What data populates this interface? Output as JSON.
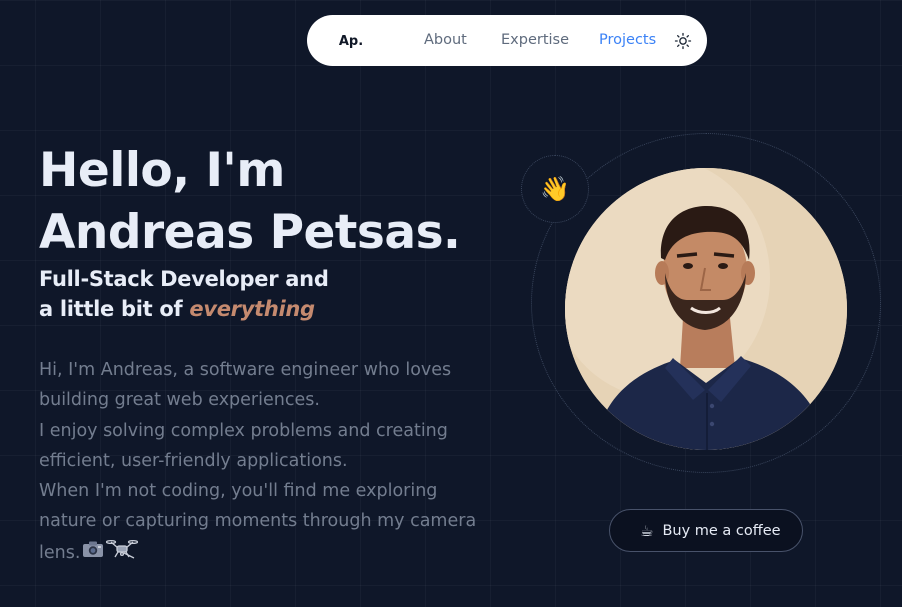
{
  "nav": {
    "logo": "Ap.",
    "links": [
      "About",
      "Expertise",
      "Projects"
    ],
    "active": "Projects",
    "theme_icon": "sun-icon"
  },
  "hero": {
    "title_line1": "Hello, I'm",
    "title_line2": "Andreas Petsas.",
    "subtitle_line1": "Full-Stack Developer and",
    "subtitle_line2_prefix": "a little bit of ",
    "subtitle_accent": "everything",
    "bio_lines": [
      "Hi, I'm Andreas, a software engineer who loves",
      "building great web experiences.",
      "I enjoy solving complex problems and creating",
      "efficient, user-friendly applications.",
      "When I'm not coding, you'll find me exploring",
      "nature or capturing moments through my camera",
      "lens."
    ],
    "bio_icons": [
      "camera-icon",
      "drone-icon"
    ],
    "wave_emoji": "👋"
  },
  "coffee": {
    "label": "Buy me a coffee",
    "icon": "☕"
  },
  "colors": {
    "background": "#0f1729",
    "accent_blue": "#3b82f6",
    "accent_copper": "#c58a6f",
    "muted_text": "#737d8f"
  }
}
